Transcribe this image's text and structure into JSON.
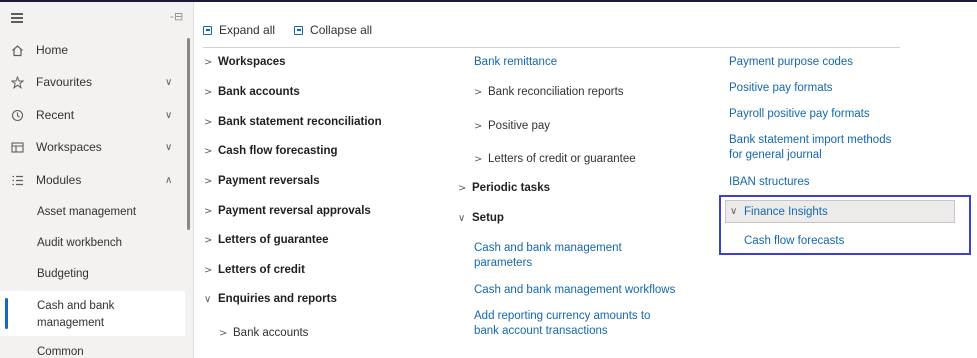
{
  "sidebar": {
    "pin_icon": "-⊟",
    "items": [
      {
        "label": "Home",
        "icon": "home-icon",
        "chev": ""
      },
      {
        "label": "Favourites",
        "icon": "star-icon",
        "chev": "∨"
      },
      {
        "label": "Recent",
        "icon": "clock-icon",
        "chev": "∨"
      },
      {
        "label": "Workspaces",
        "icon": "workspaces-icon",
        "chev": "∨"
      },
      {
        "label": "Modules",
        "icon": "modules-icon",
        "chev": "∧"
      }
    ],
    "modules": [
      {
        "label": "Asset management"
      },
      {
        "label": "Audit workbench"
      },
      {
        "label": "Budgeting"
      },
      {
        "label": "Cash and bank management",
        "selected": true
      },
      {
        "label": "Common"
      }
    ]
  },
  "toolbar": {
    "expand_all": "Expand all",
    "collapse_all": "Collapse all"
  },
  "col1": [
    {
      "label": "Workspaces",
      "chev": ">"
    },
    {
      "label": "Bank accounts",
      "chev": ">"
    },
    {
      "label": "Bank statement reconciliation",
      "chev": ">"
    },
    {
      "label": "Cash flow forecasting",
      "chev": ">"
    },
    {
      "label": "Payment reversals",
      "chev": ">"
    },
    {
      "label": "Payment reversal approvals",
      "chev": ">"
    },
    {
      "label": "Letters of guarantee",
      "chev": ">"
    },
    {
      "label": "Letters of credit",
      "chev": ">"
    },
    {
      "label": "Enquiries and reports",
      "chev": "∨"
    },
    {
      "label": "Bank accounts",
      "chev": ">"
    }
  ],
  "col2": [
    {
      "label": "Bank remittance"
    },
    {
      "label": "Bank reconciliation reports",
      "chev": ">"
    },
    {
      "label": "Positive pay",
      "chev": ">"
    },
    {
      "label": "Letters of credit or guarantee",
      "chev": ">"
    },
    {
      "label": "Periodic tasks",
      "chev": ">"
    },
    {
      "label": "Setup",
      "chev": "∨"
    },
    {
      "label": "Cash and bank management parameters"
    },
    {
      "label": "Cash and bank management workflows"
    },
    {
      "label": "Add reporting currency amounts to bank account transactions"
    }
  ],
  "col3": [
    {
      "label": "Payment purpose codes"
    },
    {
      "label": "Positive pay formats"
    },
    {
      "label": "Payroll positive pay formats"
    },
    {
      "label": "Bank statement import methods for general journal"
    },
    {
      "label": "IBAN structures"
    }
  ],
  "finance_insights": {
    "header": "Finance Insights",
    "chev": "∨",
    "items": [
      {
        "label": "Cash flow forecasts"
      }
    ]
  }
}
